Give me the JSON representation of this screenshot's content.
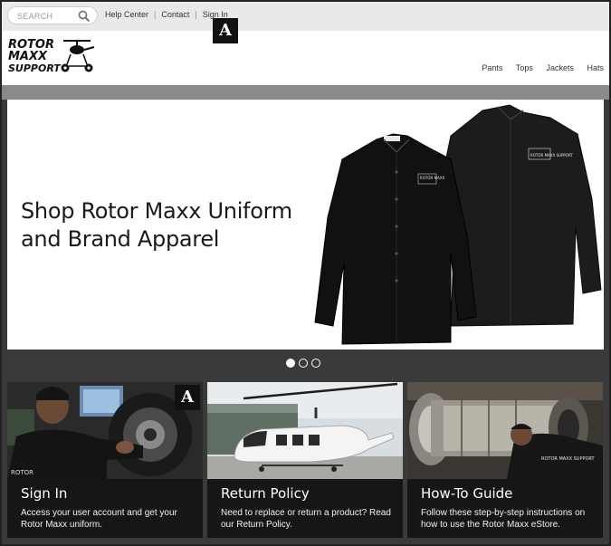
{
  "search": {
    "placeholder": "SEARCH"
  },
  "toplinks": [
    {
      "label": "Help Center"
    },
    {
      "label": "Contact"
    },
    {
      "label": "Sign In"
    }
  ],
  "badge": {
    "letter": "A"
  },
  "logo": {
    "line1": "ROTOR",
    "line2": "MAXX",
    "line3": "SUPPORT"
  },
  "nav": [
    {
      "label": "Pants"
    },
    {
      "label": "Tops"
    },
    {
      "label": "Jackets"
    },
    {
      "label": "Hats"
    }
  ],
  "hero": {
    "title_line1": "Shop Rotor Maxx Uniform",
    "title_line2": "and Brand Apparel",
    "shirt_logo": "ROTOR MAXX SUPPORT"
  },
  "carousel": {
    "count": 3,
    "active": 1
  },
  "cards": [
    {
      "title": "Sign In",
      "desc": "Access your user account and get your Rotor Maxx uniform.",
      "shirt_text": "ROTOR"
    },
    {
      "title": "Return Policy",
      "desc": "Need to replace or return a product? Read our Return Policy."
    },
    {
      "title": "How-To Guide",
      "desc": "Follow these step-by-step instructions on how to use the Rotor Maxx eStore.",
      "shirt_text": "ROTOR MAXX SUPPORT"
    }
  ],
  "colors": {
    "badge": "#111111",
    "topbar": "#e9e9e9",
    "greybar": "#8a8a8a",
    "card_bg": "#161616"
  }
}
